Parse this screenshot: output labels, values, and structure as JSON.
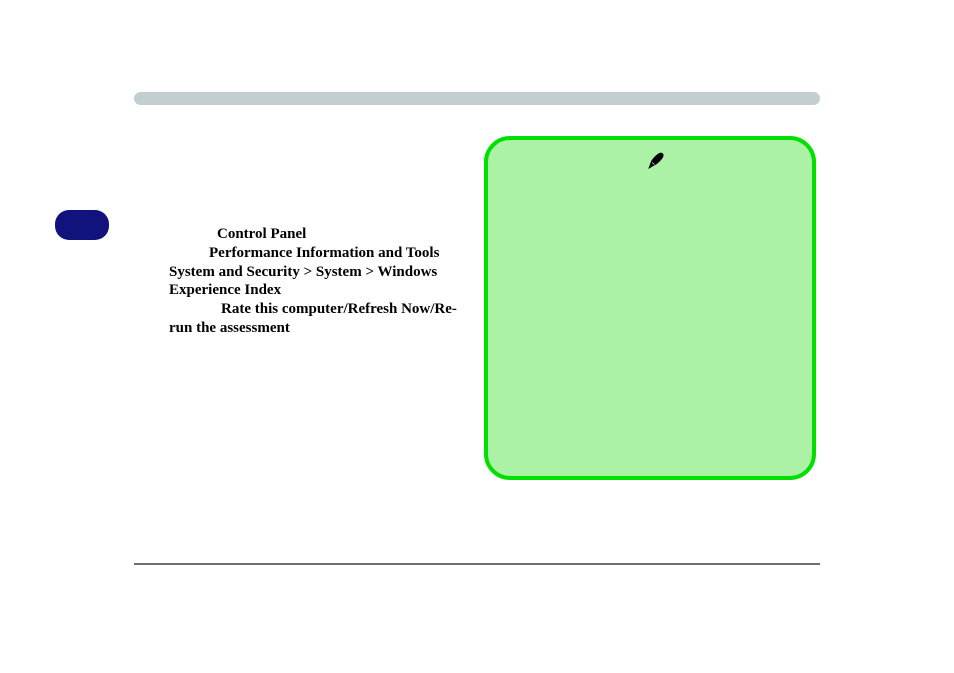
{
  "instructions": {
    "line1": "Control Panel",
    "line2": "Performance Information and Tools",
    "line3": "System and Security > System > Windows Experience Index",
    "line4": "Rate this computer/Refresh Now/Re-run the assessment"
  }
}
